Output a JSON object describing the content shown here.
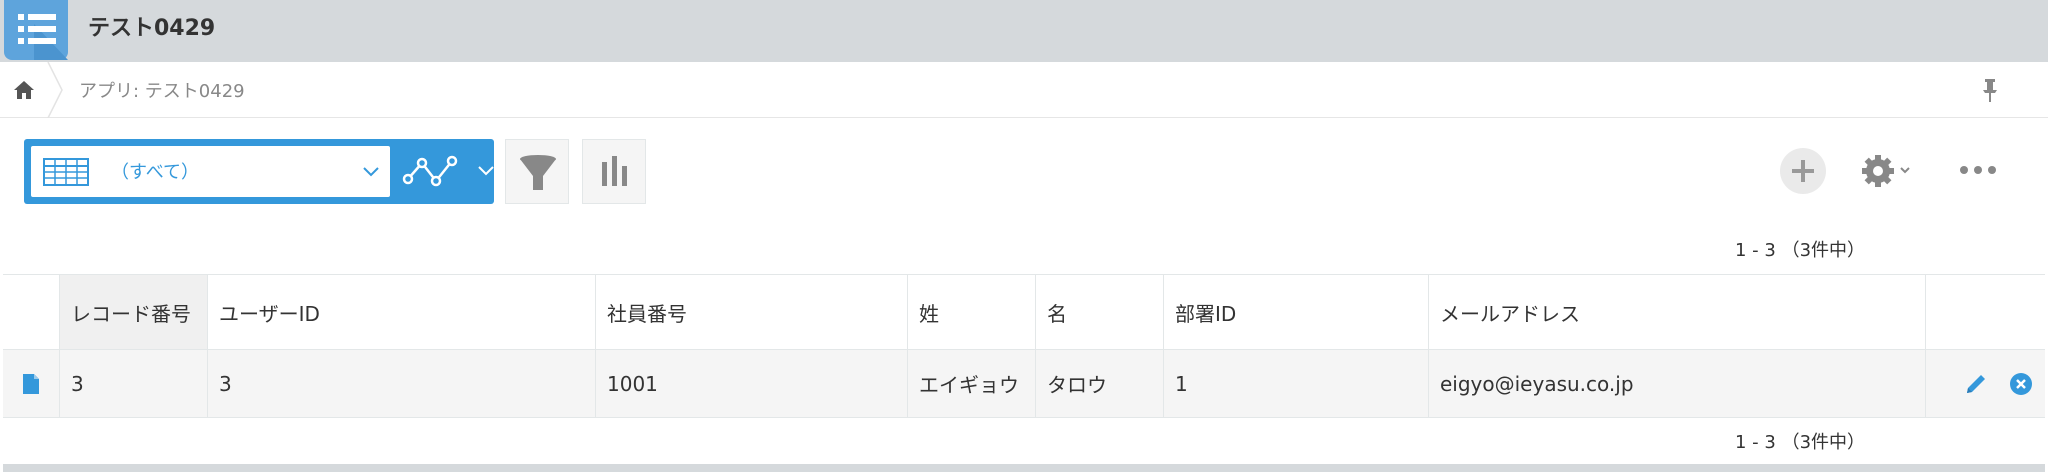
{
  "header": {
    "title": "テスト0429",
    "app_icon": "list-icon"
  },
  "breadcrumb": {
    "app_label": "アプリ: テスト0429",
    "home_icon": "home-icon",
    "pin_icon": "pin-icon"
  },
  "toolbar": {
    "view_label": "（すべて）",
    "view_icon": "table-view-icon",
    "graph_icon": "line-graph-icon",
    "filter_icon": "filter-icon",
    "chart_icon": "bar-chart-icon",
    "add_icon": "plus-icon",
    "settings_icon": "gear-icon",
    "more_icon": "more-icon"
  },
  "pagination": {
    "top": "1 - 3 （3件中）",
    "bottom": "1 - 3 （3件中）"
  },
  "table": {
    "columns": [
      "レコード番号",
      "ユーザーID",
      "社員番号",
      "姓",
      "名",
      "部署ID",
      "メールアドレス"
    ],
    "rows": [
      {
        "record_no": "3",
        "user_id": "3",
        "employee_no": "1001",
        "last_name": "エイギョウ",
        "first_name": "タロウ",
        "dept_id": "1",
        "email": "eigyo@ieyasu.co.jp"
      }
    ]
  },
  "colors": {
    "accent": "#3498db",
    "header_bg": "#d5d9dc",
    "row_bg": "#f5f5f5"
  }
}
